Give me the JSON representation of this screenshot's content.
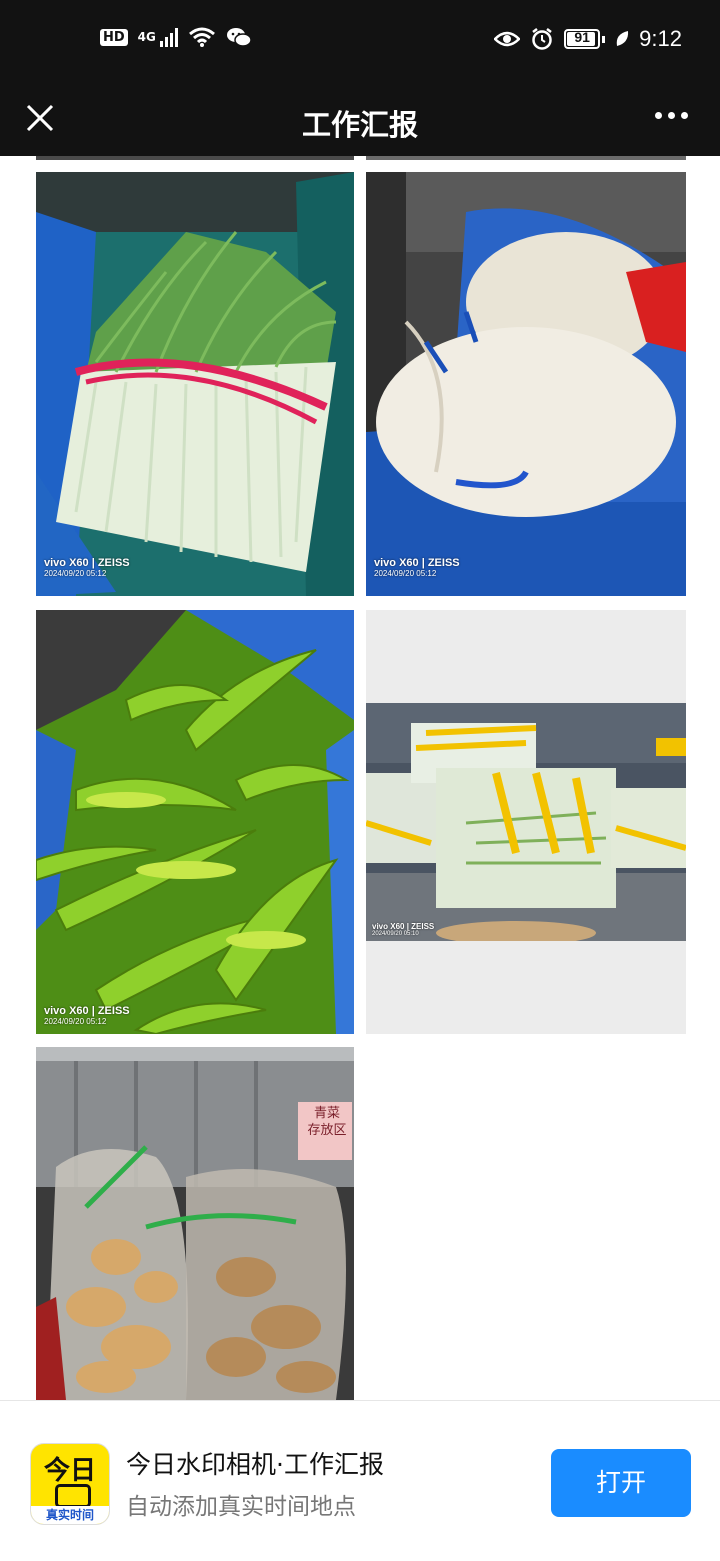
{
  "status_bar": {
    "hd": "HD",
    "net": "4G",
    "battery": "91",
    "time": "9:12"
  },
  "title_bar": {
    "title": "工作汇报"
  },
  "photos": [
    {
      "watermark_brand": "vivo X60 | ZEISS",
      "watermark_time": "2024/09/20 05:12"
    },
    {
      "watermark_brand": "vivo X60 | ZEISS",
      "watermark_time": "2024/09/20 05:12"
    },
    {
      "watermark_brand": "vivo X60 | ZEISS",
      "watermark_time": "2024/09/20 05:12"
    },
    {
      "watermark_brand": "vivo X60 | ZEISS",
      "watermark_time": "2024/09/20 05:10"
    },
    {
      "sign_line1": "青菜",
      "sign_line2": "存放区"
    }
  ],
  "banner": {
    "icon_big": "今日",
    "icon_strip": "真实时间",
    "title": "今日水印相机·工作汇报",
    "subtitle": "自动添加真实时间地点",
    "open_label": "打开"
  },
  "colors": {
    "bar_bg": "#121212",
    "accent": "#1a8cff",
    "icon_yellow": "#ffe400"
  }
}
